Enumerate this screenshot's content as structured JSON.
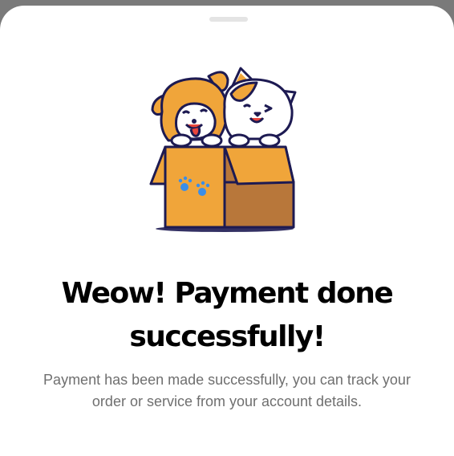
{
  "sheet": {
    "illustration_icon": "dog-and-cat-in-box-illustration",
    "title_line1": "Weow! Payment done",
    "title_line2": "successfully!",
    "description": "Payment has been made successfully, you can track your order or service from your account details."
  },
  "colors": {
    "background_overlay": "#7a7a7a",
    "sheet": "#ffffff",
    "title": "#000000",
    "description": "#6f6f6f",
    "box_orange": "#f0a53a",
    "box_brown": "#b8773a",
    "outline": "#1d1a52"
  }
}
